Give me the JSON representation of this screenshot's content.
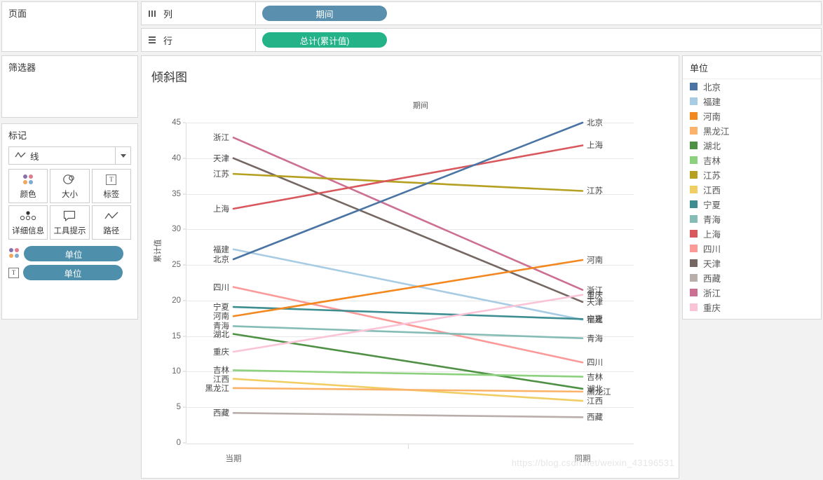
{
  "shelves": {
    "page": {
      "title": "页面"
    },
    "filters": {
      "title": "筛选器"
    },
    "columns": {
      "label": "列",
      "pill": "期间",
      "icon": "columns-icon"
    },
    "rows": {
      "label": "行",
      "pill": "总计(累计值)",
      "icon": "rows-icon"
    }
  },
  "marks": {
    "title": "标记",
    "type": "线",
    "type_icon": "line-mark-icon",
    "buttons": [
      {
        "label": "颜色",
        "icon": "color-palette-icon"
      },
      {
        "label": "大小",
        "icon": "size-icon"
      },
      {
        "label": "标签",
        "icon": "label-text-icon"
      },
      {
        "label": "详细信息",
        "icon": "detail-dots-icon"
      },
      {
        "label": "工具提示",
        "icon": "tooltip-icon"
      },
      {
        "label": "路径",
        "icon": "path-line-icon"
      }
    ],
    "pills": [
      {
        "label": "单位",
        "icon": "color-palette-icon"
      },
      {
        "label": "单位",
        "icon": "label-text-icon"
      }
    ]
  },
  "legend": {
    "title": "单位",
    "items": [
      {
        "label": "北京",
        "color": "#4a74a4"
      },
      {
        "label": "福建",
        "color": "#a8cce4"
      },
      {
        "label": "河南",
        "color": "#f2881f"
      },
      {
        "label": "黑龙江",
        "color": "#fbb36b"
      },
      {
        "label": "湖北",
        "color": "#4f9144"
      },
      {
        "label": "吉林",
        "color": "#8cd17d"
      },
      {
        "label": "江苏",
        "color": "#b5a021"
      },
      {
        "label": "江西",
        "color": "#f1ce63"
      },
      {
        "label": "宁夏",
        "color": "#3e8e91"
      },
      {
        "label": "青海",
        "color": "#86bcb6"
      },
      {
        "label": "上海",
        "color": "#d9585d"
      },
      {
        "label": "四川",
        "color": "#fc9a99"
      },
      {
        "label": "天津",
        "color": "#766763"
      },
      {
        "label": "西藏",
        "color": "#baaeaa"
      },
      {
        "label": "浙江",
        "color": "#cd6f92"
      },
      {
        "label": "重庆",
        "color": "#fbc4d6"
      }
    ]
  },
  "watermark": "https://blog.csdn.net/weixin_43196531",
  "chart_data": {
    "type": "line",
    "title": "倾斜图",
    "column_header": "期间",
    "xlabel": "",
    "ylabel": "累计值",
    "categories": [
      "当期",
      "同期"
    ],
    "ylim": [
      0,
      45
    ],
    "yticks": [
      0,
      5,
      10,
      15,
      20,
      25,
      30,
      35,
      40,
      45
    ],
    "grid": true,
    "legend_position": "right",
    "series": [
      {
        "name": "浙江",
        "color": "#cd6f92",
        "values": [
          42.9,
          21.5
        ]
      },
      {
        "name": "天津",
        "color": "#766763",
        "values": [
          40.0,
          19.8
        ]
      },
      {
        "name": "江苏",
        "color": "#b5a021",
        "values": [
          37.8,
          35.4
        ]
      },
      {
        "name": "上海",
        "color": "#d9585d",
        "values": [
          32.9,
          41.8
        ]
      },
      {
        "name": "福建",
        "color": "#a8cce4",
        "values": [
          27.2,
          17.3
        ]
      },
      {
        "name": "北京",
        "color": "#4a74a4",
        "values": [
          25.8,
          45.0
        ]
      },
      {
        "name": "四川",
        "color": "#fc9a99",
        "values": [
          21.9,
          11.3
        ]
      },
      {
        "name": "宁夏",
        "color": "#3e8e91",
        "values": [
          19.1,
          17.4
        ]
      },
      {
        "name": "河南",
        "color": "#f2881f",
        "values": [
          17.8,
          25.7
        ]
      },
      {
        "name": "青海",
        "color": "#86bcb6",
        "values": [
          16.4,
          14.7
        ]
      },
      {
        "name": "湖北",
        "color": "#4f9144",
        "values": [
          15.3,
          7.6
        ]
      },
      {
        "name": "重庆",
        "color": "#fbc4d6",
        "values": [
          12.8,
          20.8
        ]
      },
      {
        "name": "吉林",
        "color": "#8cd17d",
        "values": [
          10.2,
          9.3
        ]
      },
      {
        "name": "江西",
        "color": "#f1ce63",
        "values": [
          9.0,
          5.9
        ]
      },
      {
        "name": "黑龙江",
        "color": "#fbb36b",
        "values": [
          7.7,
          7.2
        ]
      },
      {
        "name": "西藏",
        "color": "#baaeaa",
        "values": [
          4.2,
          3.6
        ]
      }
    ],
    "left_labels": [
      {
        "name": "浙江",
        "value": 42.9
      },
      {
        "name": "天津",
        "value": 40.0
      },
      {
        "name": "江苏",
        "value": 37.8
      },
      {
        "name": "上海",
        "value": 32.9
      },
      {
        "name": "福建",
        "value": 27.2
      },
      {
        "name": "北京",
        "value": 25.8
      },
      {
        "name": "四川",
        "value": 21.9
      },
      {
        "name": "宁夏",
        "value": 19.1
      },
      {
        "name": "河南",
        "value": 17.8
      },
      {
        "name": "青海",
        "value": 16.4
      },
      {
        "name": "湖北",
        "value": 15.3
      },
      {
        "name": "重庆",
        "value": 12.8
      },
      {
        "name": "吉林",
        "value": 10.2
      },
      {
        "name": "江西",
        "value": 9.0
      },
      {
        "name": "黑龙江",
        "value": 7.7
      },
      {
        "name": "西藏",
        "value": 4.2
      }
    ],
    "right_labels": [
      {
        "name": "北京",
        "value": 45.0
      },
      {
        "name": "上海",
        "value": 41.8
      },
      {
        "name": "江苏",
        "value": 35.4
      },
      {
        "name": "河南",
        "value": 25.7
      },
      {
        "name": "浙江",
        "value": 21.5
      },
      {
        "name": "重庆",
        "value": 20.8
      },
      {
        "name": "天津",
        "value": 19.8
      },
      {
        "name": "宁夏",
        "value": 17.4
      },
      {
        "name": "福建",
        "value": 17.3
      },
      {
        "name": "青海",
        "value": 14.7
      },
      {
        "name": "四川",
        "value": 11.3
      },
      {
        "name": "吉林",
        "value": 9.3
      },
      {
        "name": "湖北",
        "value": 7.6
      },
      {
        "name": "黑龙江",
        "value": 7.2
      },
      {
        "name": "江西",
        "value": 5.9
      },
      {
        "name": "西藏",
        "value": 3.6
      }
    ]
  }
}
